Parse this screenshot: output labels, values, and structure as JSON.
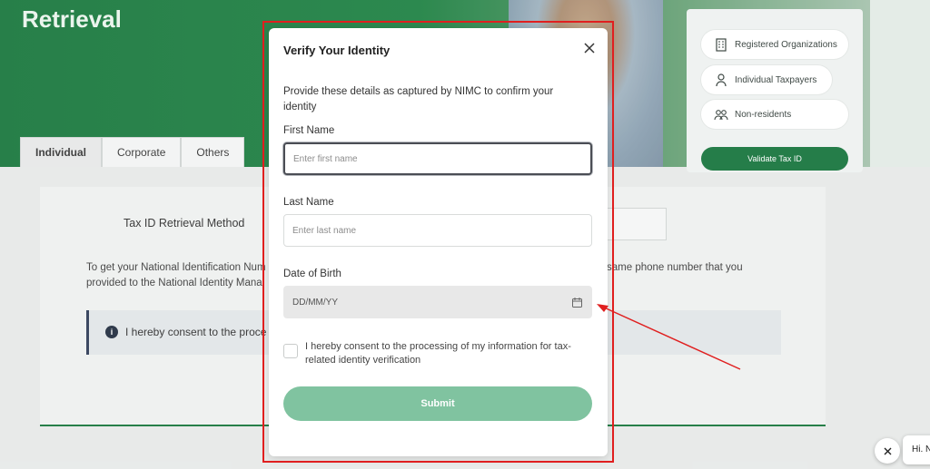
{
  "hero": {
    "title": "Retrieval"
  },
  "side_menu": {
    "items": [
      {
        "label": "Registered Organizations",
        "icon": "building-icon"
      },
      {
        "label": "Individual Taxpayers",
        "icon": "person-icon"
      },
      {
        "label": "Non-residents",
        "icon": "group-icon"
      }
    ],
    "validate_label": "Validate Tax ID"
  },
  "tabs": [
    {
      "label": "Individual",
      "active": true
    },
    {
      "label": "Corporate",
      "active": false
    },
    {
      "label": "Others",
      "active": false
    }
  ],
  "page": {
    "method_label": "Tax ID Retrieval Method",
    "info_line1_left": "To get your National Identification Num",
    "info_line1_right": "same phone number that you",
    "info_line2": "provided to the National Identity Mana",
    "consent_banner": "I hereby consent to the proce"
  },
  "modal": {
    "title": "Verify Your Identity",
    "description": "Provide these details as captured by NIMC to confirm your identity",
    "first_name": {
      "label": "First Name",
      "placeholder": "Enter first name",
      "value": ""
    },
    "last_name": {
      "label": "Last Name",
      "placeholder": "Enter last name",
      "value": ""
    },
    "dob": {
      "label": "Date of Birth",
      "placeholder": "DD/MM/YY"
    },
    "consent": "I hereby consent to the processing of my information for tax-related identity verification",
    "submit_label": "Submit"
  },
  "chat": {
    "greeting": "Hi. N"
  },
  "colors": {
    "brand_green": "#15753a",
    "submit_green": "#80c3a0",
    "annotation_red": "#e01f1f"
  }
}
